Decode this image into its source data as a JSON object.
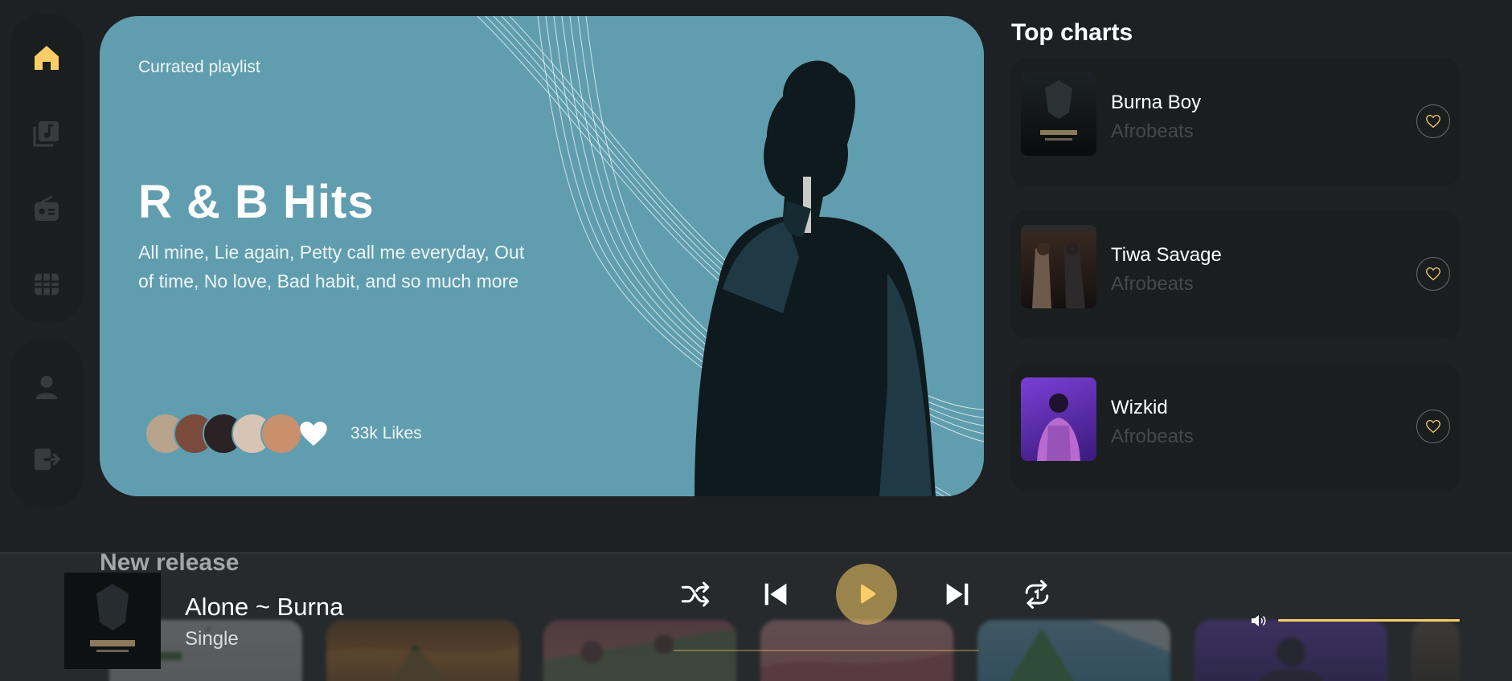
{
  "sidebar": {
    "main_items": [
      {
        "name": "home-icon",
        "active": true
      },
      {
        "name": "playlist-icon",
        "active": false
      },
      {
        "name": "radio-icon",
        "active": false
      },
      {
        "name": "videos-icon",
        "active": false
      }
    ],
    "secondary_items": [
      {
        "name": "profile-icon"
      },
      {
        "name": "logout-icon"
      }
    ]
  },
  "hero": {
    "caption": "Currated playlist",
    "title": "R & B Hits",
    "description": "All mine, Lie again, Petty call me everyday, Out of time, No love, Bad habit, and so much more",
    "likes": "33k Likes"
  },
  "top_charts": {
    "title": "Top charts",
    "items": [
      {
        "artist": "Burna Boy",
        "genre": "Afrobeats"
      },
      {
        "artist": "Tiwa Savage",
        "genre": "Afrobeats"
      },
      {
        "artist": "Wizkid",
        "genre": "Afrobeats"
      }
    ]
  },
  "new_release": {
    "title": "New release"
  },
  "player": {
    "track_title": "Alone ~ Burna",
    "track_type": "Single"
  },
  "colors": {
    "accent": "#facd66",
    "background": "#1d2123",
    "hero": "#609eaf",
    "card": "#1a1e1f"
  }
}
